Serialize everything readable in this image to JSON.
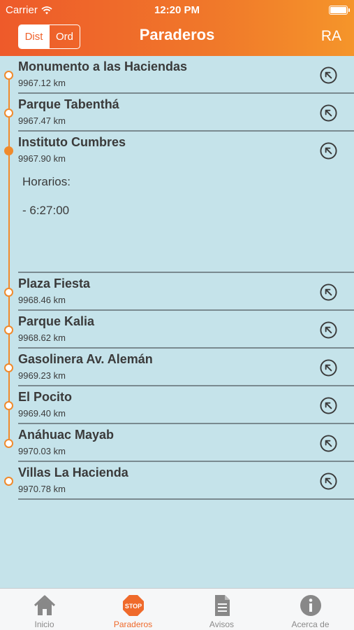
{
  "status_bar": {
    "carrier": "Carrier",
    "time": "12:20 PM"
  },
  "header": {
    "sort_segment": [
      "Dist",
      "Ord"
    ],
    "title": "Paraderos",
    "ra_label": "RA",
    "accent_color": "#ef622b"
  },
  "stops": [
    {
      "name": "Monumento a las Haciendas",
      "distance": "9967.12 km"
    },
    {
      "name": "Parque Tabenthá",
      "distance": "9967.47 km"
    },
    {
      "name": "Instituto Cumbres",
      "distance": "9967.90 km",
      "expanded": true,
      "schedule_label": "Horarios:",
      "schedule_times": [
        "- 6:27:00"
      ]
    },
    {
      "name": "Plaza Fiesta",
      "distance": "9968.46 km"
    },
    {
      "name": "Parque Kalia",
      "distance": "9968.62 km"
    },
    {
      "name": "Gasolinera Av. Alemán",
      "distance": "9969.23 km"
    },
    {
      "name": "El Pocito",
      "distance": "9969.40 km"
    },
    {
      "name": "Anáhuac Mayab",
      "distance": "9970.03 km"
    },
    {
      "name": "Villas La Hacienda",
      "distance": "9970.78 km"
    }
  ],
  "tab_bar": [
    {
      "label": "Inicio",
      "icon": "home-icon"
    },
    {
      "label": "Paraderos",
      "icon": "stop-sign-icon",
      "active": true
    },
    {
      "label": "Avisos",
      "icon": "document-icon"
    },
    {
      "label": "Acerca de",
      "icon": "info-icon"
    }
  ]
}
